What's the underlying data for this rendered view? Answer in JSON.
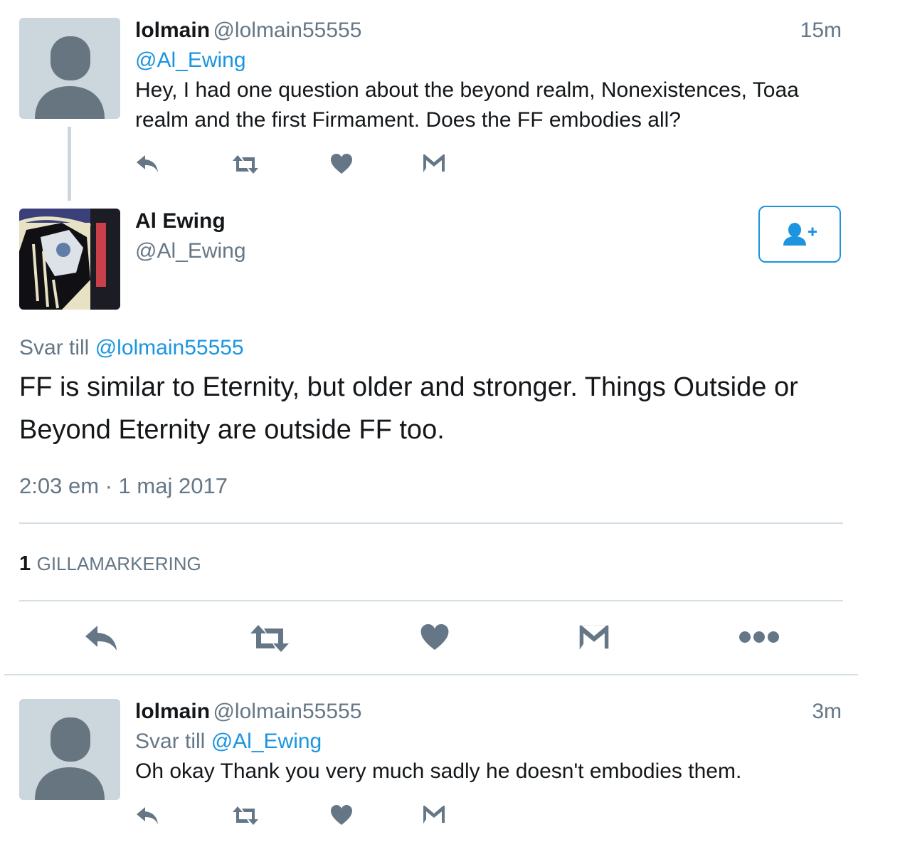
{
  "tweet1": {
    "name": "lolmain",
    "handle": "@lolmain55555",
    "time": "15m",
    "mention": "@Al_Ewing",
    "text_line1": "Hey, I had one question about the beyond realm, Nonexistences, Toaa",
    "text_line2": "realm and the first Firmament. Does the FF embodies all?",
    "actions": [
      "reply-icon",
      "retweet-icon",
      "like-icon",
      "message-icon"
    ]
  },
  "main_tweet": {
    "name": "Al Ewing",
    "handle": "@Al_Ewing",
    "follow_icon": "follow-user-icon",
    "reply_prefix": "Svar till",
    "reply_to": "@lolmain55555",
    "text_line1": "FF is similar to Eternity, but older and stronger. Things Outside or",
    "text_line2": "Beyond Eternity are outside FF too.",
    "timestamp": "2:03 em · 1 maj 2017",
    "likes_count": "1",
    "likes_label": "GILLAMARKERING",
    "actions": [
      "reply-icon",
      "retweet-icon",
      "like-icon",
      "message-icon",
      "more-icon"
    ]
  },
  "tweet2": {
    "name": "lolmain",
    "handle": "@lolmain55555",
    "time": "3m",
    "reply_prefix": "Svar till",
    "reply_to": "@Al_Ewing",
    "text": "Oh okay Thank you very much sadly he doesn't embodies them.",
    "actions": [
      "reply-icon",
      "retweet-icon",
      "like-icon",
      "message-icon"
    ]
  },
  "colors": {
    "link": "#1b95e0",
    "muted": "#657786",
    "divider": "#d4dfe6",
    "avatar_bg": "#ccd6dd"
  }
}
